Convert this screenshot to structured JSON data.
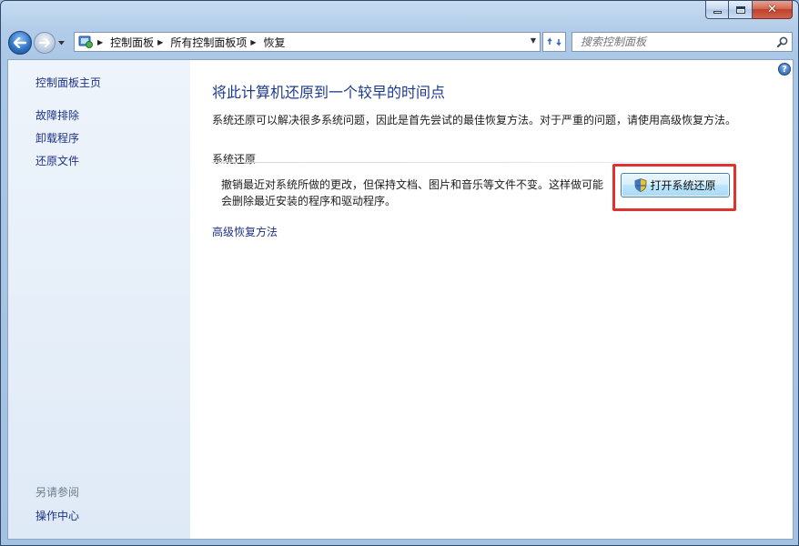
{
  "window": {
    "close_glyph": "✕"
  },
  "nav": {
    "breadcrumbs": [
      "控制面板",
      "所有控制面板项",
      "恢复"
    ],
    "search_placeholder": "搜索控制面板"
  },
  "sidebar": {
    "home_link": "控制面板主页",
    "links": [
      "故障排除",
      "卸载程序",
      "还原文件"
    ],
    "see_also_header": "另请参阅",
    "see_also_links": [
      "操作中心"
    ]
  },
  "main": {
    "title": "将此计算机还原到一个较早的时间点",
    "description": "系统还原可以解决很多系统问题，因此是首先尝试的最佳恢复方法。对于严重的问题，请使用高级恢复方法。",
    "section_header": "系统还原",
    "section_description_line1": "撤销最近对系统所做的更改，但保持文档、图片和音乐等文件不变。这样做可能",
    "section_description_line2": "会删除最近安装的程序和驱动程序。",
    "open_button_label": "打开系统还原",
    "advanced_link": "高级恢复方法",
    "help_glyph": "?"
  },
  "colors": {
    "link": "#1e3287",
    "title": "#1c3b8c",
    "highlight": "#e0332d"
  }
}
